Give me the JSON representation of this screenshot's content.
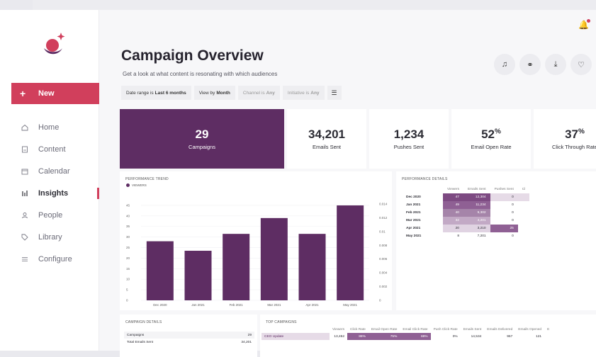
{
  "sidebar": {
    "new_label": "New",
    "items": [
      {
        "label": "Home",
        "icon": "home-icon",
        "active": false
      },
      {
        "label": "Content",
        "icon": "document-icon",
        "active": false
      },
      {
        "label": "Calendar",
        "icon": "calendar-icon",
        "active": false
      },
      {
        "label": "Insights",
        "icon": "chart-icon",
        "active": true
      },
      {
        "label": "People",
        "icon": "person-icon",
        "active": false
      },
      {
        "label": "Library",
        "icon": "tag-icon",
        "active": false
      },
      {
        "label": "Configure",
        "icon": "sliders-icon",
        "active": false
      }
    ]
  },
  "header": {
    "title": "Campaign Overview",
    "subtitle": "Get a look at what content is resonating with which audiences"
  },
  "filters": {
    "date_range_label": "Date range is",
    "date_range_value": "Last 6 months",
    "view_label": "View by",
    "view_value": "Month",
    "channel_label": "Channel is",
    "channel_value": "Any",
    "initiative_label": "Initiative is",
    "initiative_value": "Any"
  },
  "kpis": [
    {
      "value": "29",
      "suffix": "",
      "label": "Campaigns"
    },
    {
      "value": "34,201",
      "suffix": "",
      "label": "Emails Sent"
    },
    {
      "value": "1,234",
      "suffix": "",
      "label": "Pushes Sent"
    },
    {
      "value": "52",
      "suffix": "%",
      "label": "Email Open Rate"
    },
    {
      "value": "37",
      "suffix": "%",
      "label": "Click Through Rate"
    }
  ],
  "trend": {
    "title": "PERFORMANCE TREND",
    "legend": "VIEWERS"
  },
  "chart_data": {
    "type": "bar",
    "categories": [
      "Dec 2020",
      "Jan 2021",
      "Feb 2021",
      "Mar 2021",
      "Apr 2021",
      "May 2021"
    ],
    "series": [
      {
        "name": "VIEWERS",
        "values": [
          28,
          23.5,
          31.5,
          39,
          31.5,
          45
        ]
      }
    ],
    "left_ticks": [
      0,
      5,
      10,
      15,
      20,
      25,
      30,
      35,
      40,
      45
    ],
    "right_ticks": [
      "0",
      "0.002",
      "0.004",
      "0.006",
      "0.008",
      "0.01",
      "0.012",
      "0.014"
    ],
    "ylim": [
      0,
      47
    ],
    "bar_color": "#5e2d63"
  },
  "perf": {
    "title": "PERFORMANCE DETAILS",
    "columns": [
      "Viewers",
      "Emails Sent",
      "Pushes Sent",
      "Cl"
    ],
    "rows": [
      {
        "label": "Dec 2020",
        "values": [
          "47",
          "12,304",
          "0",
          ""
        ]
      },
      {
        "label": "Jan 2021",
        "values": [
          "49",
          "11,234",
          "0",
          ""
        ]
      },
      {
        "label": "Feb 2021",
        "values": [
          "40",
          "9,302",
          "0",
          ""
        ]
      },
      {
        "label": "Mar 2021",
        "values": [
          "32",
          "4,201",
          "0",
          ""
        ]
      },
      {
        "label": "Apr 2021",
        "values": [
          "20",
          "3,210",
          "25",
          ""
        ]
      },
      {
        "label": "May 2021",
        "values": [
          "8",
          "7,201",
          "0",
          ""
        ]
      }
    ]
  },
  "campaign_details": {
    "title": "CAMPAIGN DETAILS",
    "rows": [
      {
        "label": "Campaigns",
        "value": "29"
      },
      {
        "label": "Total Emails Sent",
        "value": "34,201"
      }
    ]
  },
  "top_campaigns": {
    "title": "TOP CAMPAIGNS",
    "columns": [
      "Viewers",
      "Click Rate",
      "Email Open Rate",
      "Email Click Rate",
      "Push Click Rate",
      "Emails Sent",
      "Emails Delivered",
      "Emails Opened",
      "E"
    ],
    "rows": [
      {
        "name": "CEO Update",
        "values": [
          "13,452",
          "88%",
          "75%",
          "88%",
          "0%",
          "14,534",
          "957",
          "121",
          ""
        ]
      }
    ]
  },
  "colors": {
    "brand": "#5e2d63",
    "accent": "#d13f5c"
  }
}
